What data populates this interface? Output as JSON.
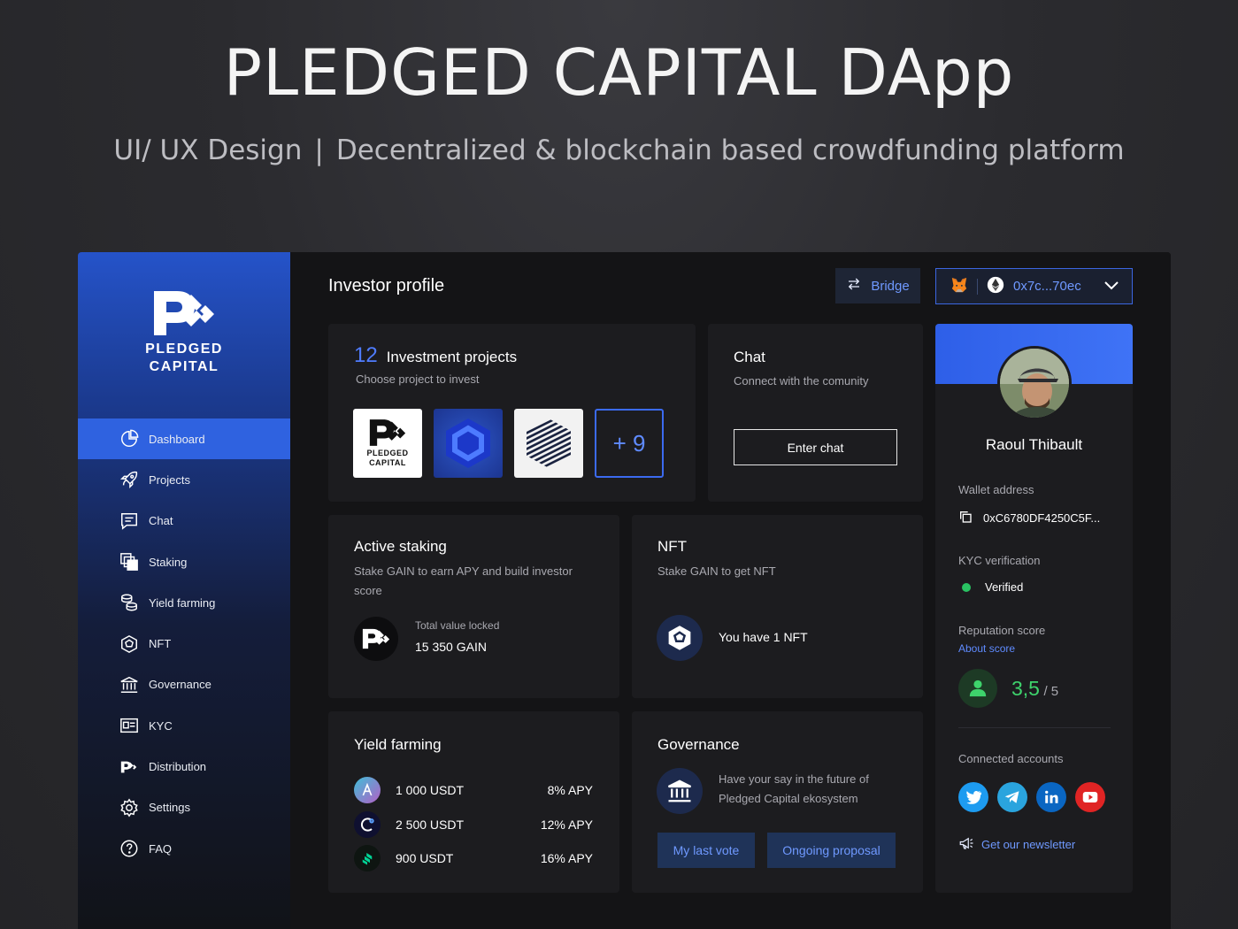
{
  "hero": {
    "title": "PLEDGED CAPITAL DApp",
    "subtitle_left": "UI/ UX Design",
    "subtitle_sep": "|",
    "subtitle_right": "Decentralized & blockchain based crowdfunding platform"
  },
  "brand": {
    "line1": "PLEDGED",
    "line2": "CAPITAL",
    "primary_color": "#2f62e0"
  },
  "sidebar": {
    "items": [
      {
        "label": "Dashboard",
        "icon": "pie-chart-icon",
        "active": true
      },
      {
        "label": "Projects",
        "icon": "rocket-icon"
      },
      {
        "label": "Chat",
        "icon": "chat-icon"
      },
      {
        "label": "Staking",
        "icon": "stack-icon"
      },
      {
        "label": "Yield farming",
        "icon": "coins-icon"
      },
      {
        "label": "NFT",
        "icon": "nft-icon"
      },
      {
        "label": "Governance",
        "icon": "bank-icon"
      },
      {
        "label": "KYC",
        "icon": "id-card-icon"
      },
      {
        "label": "Distribution",
        "icon": "pc-logo-icon"
      },
      {
        "label": "Settings",
        "icon": "gear-icon"
      },
      {
        "label": "FAQ",
        "icon": "question-icon"
      }
    ]
  },
  "header": {
    "title": "Investor profile",
    "bridge_label": "Bridge",
    "wallet_address": "0x7c...70ec"
  },
  "invest": {
    "count": "12",
    "title": "Investment projects",
    "subtitle": "Choose project to invest",
    "tile1_line1": "PLEDGED",
    "tile1_line2": "CAPITAL",
    "more": "+ 9"
  },
  "chat": {
    "title": "Chat",
    "subtitle": "Connect with the comunity",
    "button": "Enter chat"
  },
  "staking": {
    "title": "Active staking",
    "subtitle": "Stake GAIN to earn APY and build investor score",
    "tvl_label": "Total value locked",
    "tvl_value": "15 350 GAIN"
  },
  "nft": {
    "title": "NFT",
    "subtitle": "Stake GAIN to get NFT",
    "text": "You have 1 NFT"
  },
  "yield": {
    "title": "Yield farming",
    "rows": [
      {
        "amount": "1 000 USDT",
        "apy": "8% APY",
        "coin": "aave-icon"
      },
      {
        "amount": "2 500 USDT",
        "apy": "12%  APY",
        "coin": "celo-icon"
      },
      {
        "amount": "900 USDT",
        "apy": "16%  APY",
        "coin": "compound-icon"
      }
    ]
  },
  "governance": {
    "title": "Governance",
    "text": "Have your say in the future of Pledged Capital ekosystem",
    "btn_last_vote": "My last vote",
    "btn_ongoing": "Ongoing proposal"
  },
  "profile": {
    "name": "Raoul Thibault",
    "wallet_label": "Wallet address",
    "wallet_value": "0xC6780DF4250C5F...",
    "kyc_label": "KYC verification",
    "kyc_value": "Verified",
    "rep_label": "Reputation score",
    "about_link": "About score",
    "score": "3,5",
    "score_max": "/ 5",
    "connected_label": "Connected accounts",
    "socials": [
      "twitter-icon",
      "telegram-icon",
      "linkedin-icon",
      "youtube-icon"
    ],
    "newsletter": "Get our newsletter"
  }
}
